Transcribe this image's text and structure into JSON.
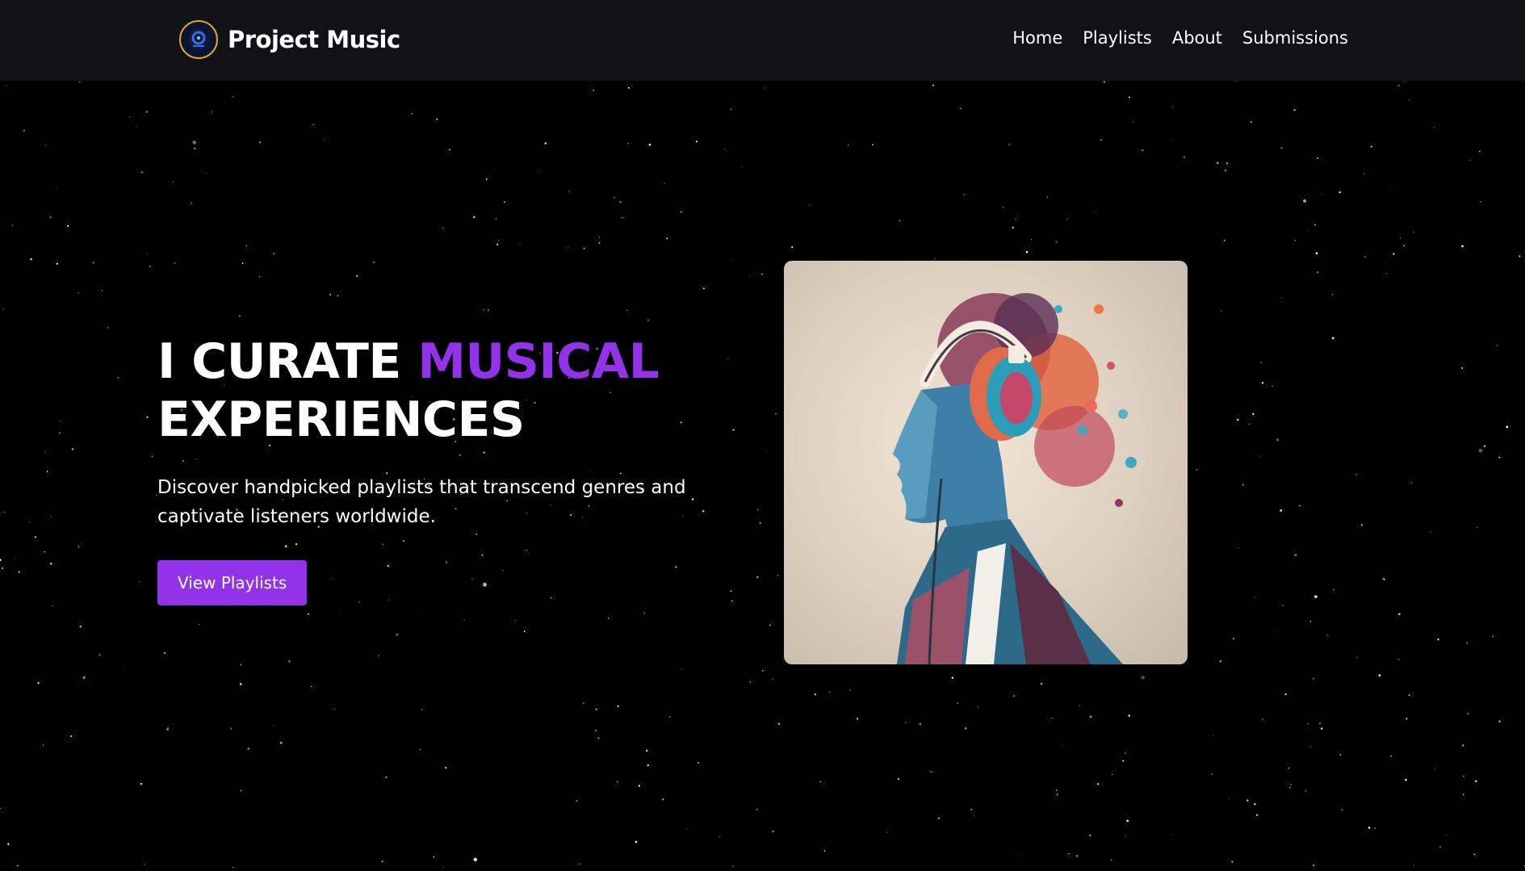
{
  "header": {
    "logo_icon": "vinyl-record-logo-icon",
    "brand": "Project Music",
    "nav": [
      {
        "label": "Home"
      },
      {
        "label": "Playlists"
      },
      {
        "label": "About"
      },
      {
        "label": "Submissions"
      }
    ]
  },
  "hero": {
    "headline_part1": "I CURATE ",
    "headline_accent": "MUSICAL",
    "headline_part2": "EXPERIENCES",
    "subtext": "Discover handpicked playlists that transcend genres and captivate listeners worldwide.",
    "cta_label": "View Playlists",
    "image_alt": "Illustrated portrait of a person wearing headphones with colorful abstract hair"
  },
  "colors": {
    "accent": "#9233ea",
    "navbar_bg": "#111216",
    "page_bg": "#000000",
    "logo_ring": "#d8a92a"
  }
}
